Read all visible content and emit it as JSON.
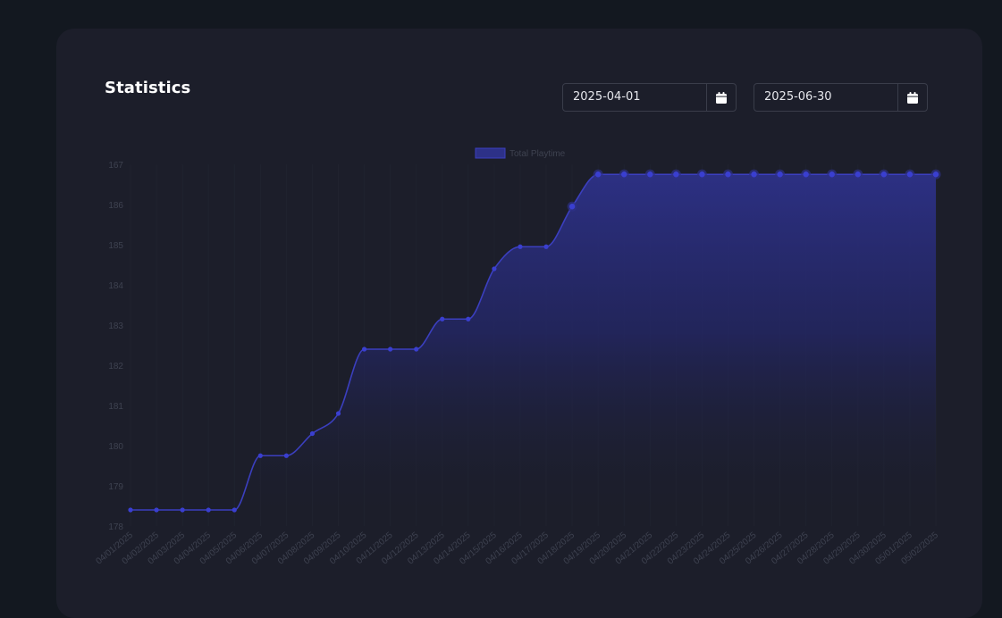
{
  "page": {
    "title": "Statistics",
    "start_date": "2025-04-01",
    "end_date": "2025-06-30",
    "calendar_icon": "calendar-icon"
  },
  "colors": {
    "background": "#131820",
    "card": "#1c1e2a",
    "line": "#3b3fbf",
    "point": "#3a3fd0",
    "fill_top": "#2d3188",
    "axis_text": "#3e4250"
  },
  "chart_data": {
    "type": "line",
    "title": "",
    "xlabel": "",
    "ylabel": "",
    "legend_position": "top-center",
    "grid": true,
    "categories": [
      "04/01/2025",
      "04/02/2025",
      "04/03/2025",
      "04/04/2025",
      "04/05/2025",
      "04/06/2025",
      "04/07/2025",
      "04/08/2025",
      "04/09/2025",
      "04/10/2025",
      "04/11/2025",
      "04/12/2025",
      "04/13/2025",
      "04/14/2025",
      "04/15/2025",
      "04/16/2025",
      "04/17/2025",
      "04/18/2025",
      "04/19/2025",
      "04/20/2025",
      "04/21/2025",
      "04/22/2025",
      "04/23/2025",
      "04/24/2025",
      "04/25/2025",
      "04/26/2025",
      "04/27/2025",
      "04/28/2025",
      "04/29/2025",
      "04/30/2025",
      "05/01/2025",
      "05/02/2025"
    ],
    "y_tick_labels": [
      "178",
      "179",
      "180",
      "181",
      "182",
      "183",
      "184",
      "185",
      "186",
      "167"
    ],
    "ylim": [
      178,
      187
    ],
    "series": [
      {
        "name": "Total Playtime",
        "values": [
          178.4,
          178.4,
          178.4,
          178.4,
          178.4,
          179.75,
          179.75,
          180.3,
          180.8,
          182.4,
          182.4,
          182.4,
          183.15,
          183.15,
          184.4,
          184.95,
          184.95,
          185.95,
          186.75,
          186.75,
          186.75,
          186.75,
          186.75,
          186.75,
          186.75,
          186.75,
          186.75,
          186.75,
          186.75,
          186.75,
          186.75,
          186.75
        ]
      }
    ]
  }
}
